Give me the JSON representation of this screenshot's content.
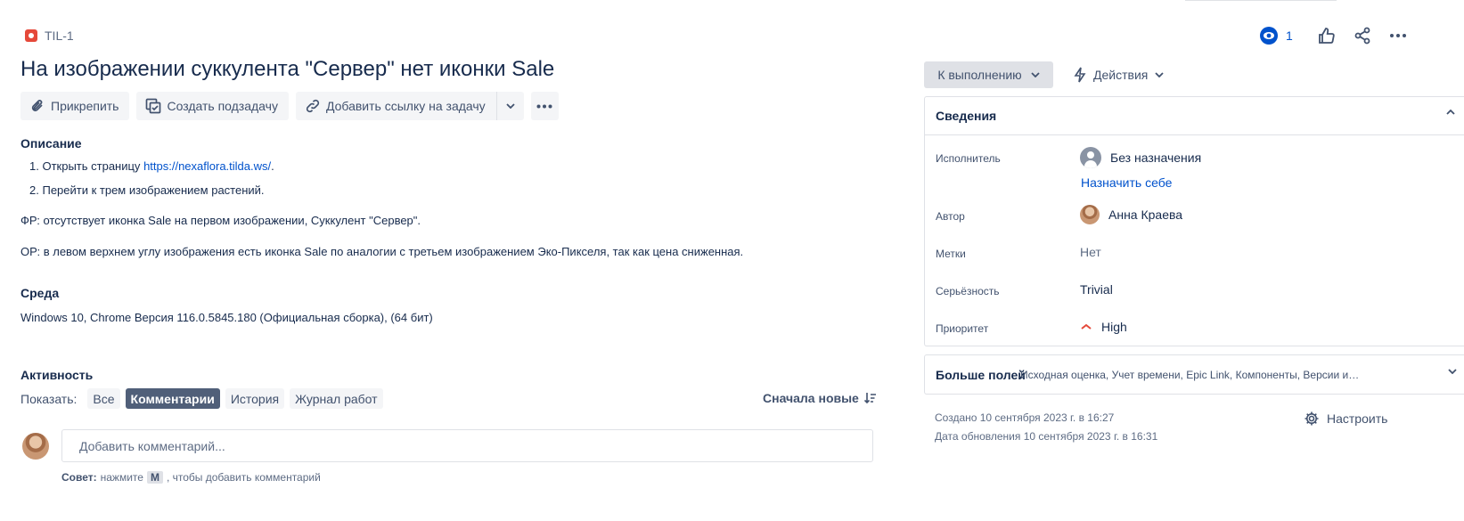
{
  "issue": {
    "key": "TIL-1",
    "title": "На изображении суккулента \"Сервер\" нет иконки Sale"
  },
  "header": {
    "watch_count": "1"
  },
  "actions": {
    "attach": "Прикрепить",
    "create_subtask": "Создать подзадачу",
    "add_link": "Добавить ссылку на задачу"
  },
  "description": {
    "heading": "Описание",
    "steps": [
      {
        "num": "1.",
        "text": "Открыть страницу ",
        "link": "https://nexaflora.tilda.ws/",
        "after": "."
      },
      {
        "num": "2.",
        "text": "Перейти к трем изображением растений."
      }
    ],
    "actual": "ФР: отсутствует иконка Sale на первом изображении, Суккулент \"Сервер\".",
    "expected": "ОР: в левом верхнем углу изображения есть иконка Sale по аналогии с третьем изображением Эко-Пикселя, так как цена сниженная."
  },
  "environment": {
    "heading": "Среда",
    "value": "Windows 10, Chrome Версия 116.0.5845.180 (Официальная сборка), (64 бит)"
  },
  "activity": {
    "heading": "Активность",
    "show_label": "Показать:",
    "filters": [
      "Все",
      "Комментарии",
      "История",
      "Журнал работ"
    ],
    "active_filter": "Комментарии",
    "sort_label": "Сначала новые",
    "comment_placeholder": "Добавить комментарий...",
    "tip_prefix": "Совет:",
    "tip_text_1": "нажмите",
    "tip_key": "M",
    "tip_text_2": ", чтобы добавить комментарий"
  },
  "status": {
    "current": "К выполнению",
    "actions_label": "Действия"
  },
  "details": {
    "heading": "Сведения",
    "assignee_label": "Исполнитель",
    "assignee_value": "Без назначения",
    "assign_to_me": "Назначить себе",
    "author_label": "Автор",
    "author_value": "Анна Краева",
    "labels_label": "Метки",
    "labels_value": "Нет",
    "severity_label": "Серьёзность",
    "severity_value": "Trivial",
    "priority_label": "Приоритет",
    "priority_value": "High",
    "priority_color": "#e5493a"
  },
  "more_fields": {
    "heading": "Больше полей",
    "list": "Исходная оценка, Учет времени, Epic Link, Компоненты, Версии исправ..."
  },
  "meta": {
    "created": "Создано 10 сентября 2023 г. в 16:27",
    "updated": "Дата обновления 10 сентября 2023 г. в 16:31",
    "configure": "Настроить"
  }
}
